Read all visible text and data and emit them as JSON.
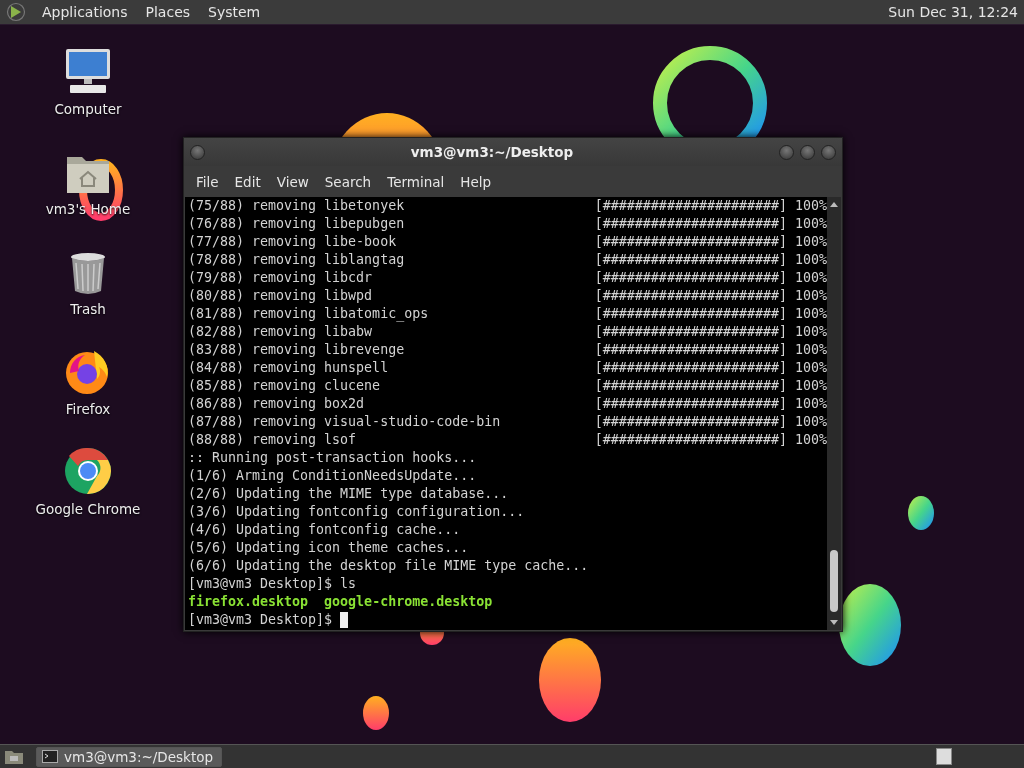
{
  "top_panel": {
    "menus": [
      "Applications",
      "Places",
      "System"
    ],
    "clock": "Sun Dec 31, 12:24"
  },
  "desktop_icons": [
    {
      "label": "Computer",
      "kind": "computer"
    },
    {
      "label": "vm3's Home",
      "kind": "home"
    },
    {
      "label": "Trash",
      "kind": "trash"
    },
    {
      "label": "Firefox",
      "kind": "firefox"
    },
    {
      "label": "Google Chrome",
      "kind": "chrome"
    }
  ],
  "terminal": {
    "title": "vm3@vm3:~/Desktop",
    "menu": [
      "File",
      "Edit",
      "View",
      "Search",
      "Terminal",
      "Help"
    ],
    "lines": [
      {
        "kind": "progress",
        "text": "(75/88) removing libetonyek",
        "bar": "[######################]",
        "percent": "100%"
      },
      {
        "kind": "progress",
        "text": "(76/88) removing libepubgen",
        "bar": "[######################]",
        "percent": "100%"
      },
      {
        "kind": "progress",
        "text": "(77/88) removing libe-book",
        "bar": "[######################]",
        "percent": "100%"
      },
      {
        "kind": "progress",
        "text": "(78/88) removing liblangtag",
        "bar": "[######################]",
        "percent": "100%"
      },
      {
        "kind": "progress",
        "text": "(79/88) removing libcdr",
        "bar": "[######################]",
        "percent": "100%"
      },
      {
        "kind": "progress",
        "text": "(80/88) removing libwpd",
        "bar": "[######################]",
        "percent": "100%"
      },
      {
        "kind": "progress",
        "text": "(81/88) removing libatomic_ops",
        "bar": "[######################]",
        "percent": "100%"
      },
      {
        "kind": "progress",
        "text": "(82/88) removing libabw",
        "bar": "[######################]",
        "percent": "100%"
      },
      {
        "kind": "progress",
        "text": "(83/88) removing librevenge",
        "bar": "[######################]",
        "percent": "100%"
      },
      {
        "kind": "progress",
        "text": "(84/88) removing hunspell",
        "bar": "[######################]",
        "percent": "100%"
      },
      {
        "kind": "progress",
        "text": "(85/88) removing clucene",
        "bar": "[######################]",
        "percent": "100%"
      },
      {
        "kind": "progress",
        "text": "(86/88) removing box2d",
        "bar": "[######################]",
        "percent": "100%"
      },
      {
        "kind": "progress",
        "text": "(87/88) removing visual-studio-code-bin",
        "bar": "[######################]",
        "percent": "100%"
      },
      {
        "kind": "progress",
        "text": "(88/88) removing lsof",
        "bar": "[######################]",
        "percent": "100%"
      },
      {
        "kind": "plain",
        "text": ":: Running post-transaction hooks..."
      },
      {
        "kind": "plain",
        "text": "(1/6) Arming ConditionNeedsUpdate..."
      },
      {
        "kind": "plain",
        "text": "(2/6) Updating the MIME type database..."
      },
      {
        "kind": "plain",
        "text": "(3/6) Updating fontconfig configuration..."
      },
      {
        "kind": "plain",
        "text": "(4/6) Updating fontconfig cache..."
      },
      {
        "kind": "plain",
        "text": "(5/6) Updating icon theme caches..."
      },
      {
        "kind": "plain",
        "text": "(6/6) Updating the desktop file MIME type cache..."
      },
      {
        "kind": "plain",
        "text": "[vm3@vm3 Desktop]$ ls"
      },
      {
        "kind": "files",
        "files": [
          "firefox.desktop",
          "google-chrome.desktop"
        ]
      },
      {
        "kind": "prompt",
        "text": "[vm3@vm3 Desktop]$",
        "cursor": true
      }
    ]
  },
  "taskbar": {
    "windows": [
      {
        "title": "vm3@vm3:~/Desktop",
        "selected": true
      }
    ]
  }
}
